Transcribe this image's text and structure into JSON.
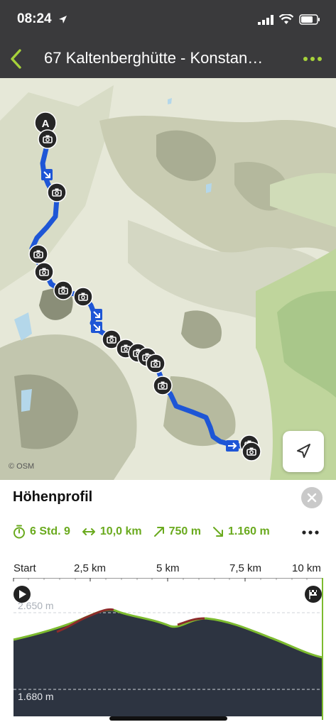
{
  "status": {
    "time": "08:24"
  },
  "nav": {
    "title": "67 Kaltenberghütte - Konstan…"
  },
  "map": {
    "attribution": "© OSM",
    "start_marker": "A"
  },
  "panel": {
    "title": "Höhenprofil",
    "stats": {
      "duration": "6 Std. 9",
      "distance": "10,0 km",
      "ascent": "750 m",
      "descent": "1.160 m"
    },
    "axis": {
      "start": "Start",
      "t1": "2,5 km",
      "t2": "5 km",
      "t3": "7,5 km",
      "t4": "10 km"
    },
    "elev_high": "2.650 m",
    "elev_low": "1.680 m"
  },
  "colors": {
    "accent": "#6aaa1e",
    "route": "#1e56d6",
    "bar": "#3a3a3c",
    "profile_fill": "#2d3441"
  }
}
